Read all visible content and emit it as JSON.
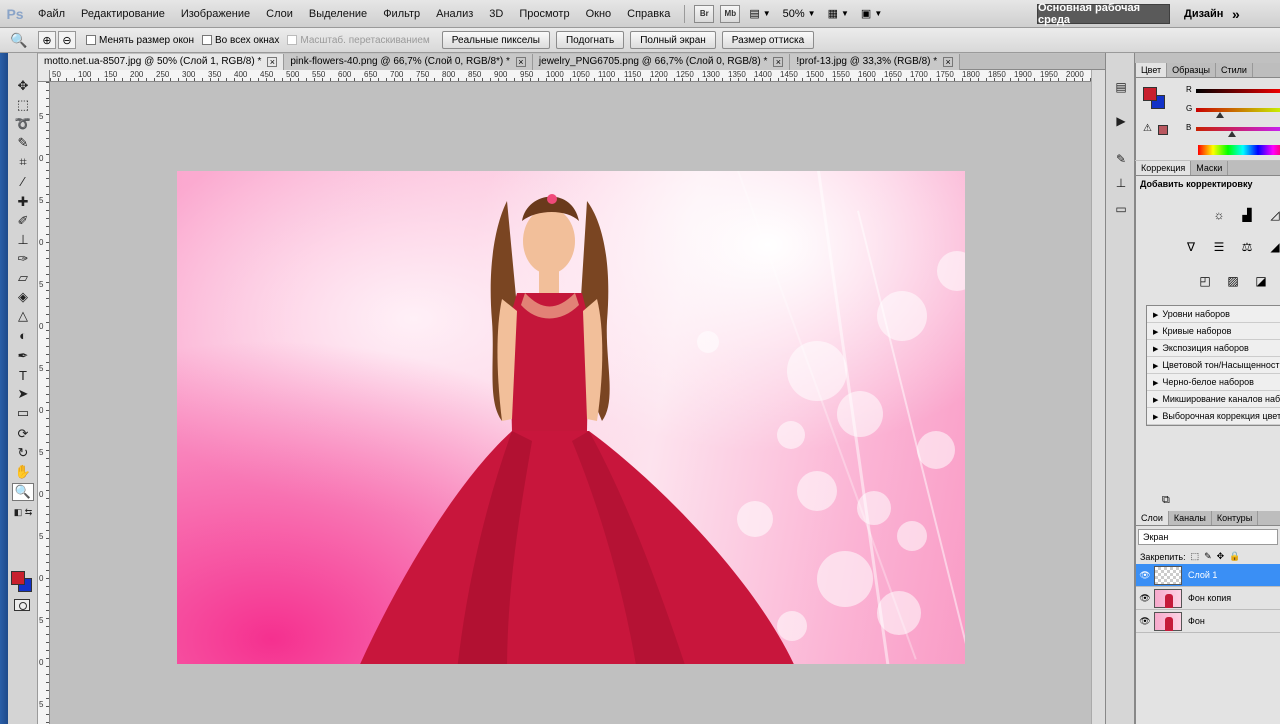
{
  "app": {
    "logo": "Ps"
  },
  "menu": {
    "items": [
      "Файл",
      "Редактирование",
      "Изображение",
      "Слои",
      "Выделение",
      "Фильтр",
      "Анализ",
      "3D",
      "Просмотр",
      "Окно",
      "Справка"
    ],
    "br_label": "Br",
    "mb_label": "Mb",
    "zoom": "50%",
    "workspace": "Основная рабочая среда",
    "design": "Дизайн",
    "more": "»"
  },
  "options": {
    "resize_windows": "Менять размер окон",
    "all_windows": "Во всех окнах",
    "scrubby_zoom": "Масштаб. перетаскиванием",
    "actual_pixels": "Реальные пикселы",
    "fit_screen": "Подогнать",
    "fill_screen": "Полный экран",
    "print_size": "Размер оттиска"
  },
  "tabs": [
    {
      "label": "motto.net.ua-8507.jpg @ 50% (Слой 1, RGB/8) *"
    },
    {
      "label": "pink-flowers-40.png @ 66,7% (Слой 0, RGB/8*) *"
    },
    {
      "label": "jewelry_PNG6705.png @ 66,7% (Слой 0, RGB/8) *"
    },
    {
      "label": "!prof-13.jpg @ 33,3% (RGB/8) *"
    }
  ],
  "rulers": {
    "top": [
      "50",
      "100",
      "150",
      "200",
      "250",
      "300",
      "350",
      "400",
      "450",
      "500",
      "550",
      "600",
      "650",
      "700",
      "750",
      "800",
      "850",
      "900",
      "950",
      "1000",
      "1050",
      "1100",
      "1150",
      "1200",
      "1250",
      "1300",
      "1350",
      "1400",
      "1450",
      "1500",
      "1550",
      "1600",
      "1650",
      "1700",
      "1750",
      "1800",
      "1850",
      "1900",
      "1950",
      "2000"
    ],
    "left": [
      "5",
      "0",
      "5",
      "0",
      "5",
      "0",
      "5",
      "0",
      "5",
      "0",
      "5",
      "0",
      "5",
      "0",
      "5"
    ]
  },
  "panels": {
    "color_tabs": [
      "Цвет",
      "Образцы",
      "Стили"
    ],
    "channels": [
      "R",
      "G",
      "B"
    ],
    "adj_tabs": [
      "Коррекция",
      "Маски"
    ],
    "adj_title": "Добавить корректировку",
    "presets": [
      "Уровни наборов",
      "Кривые наборов",
      "Экспозиция наборов",
      "Цветовой тон/Насыщенность",
      "Черно-белое наборов",
      "Микширование каналов наборов",
      "Выборочная коррекция цвета"
    ],
    "layers_tabs": [
      "Слои",
      "Каналы",
      "Контуры"
    ],
    "blend_mode": "Экран",
    "lock_label": "Закрепить:",
    "layers": [
      {
        "name": "Слой 1",
        "active": true
      },
      {
        "name": "Фон копия",
        "active": false
      },
      {
        "name": "Фон",
        "active": false
      }
    ]
  },
  "colors": {
    "foreground": "#c8202e",
    "background": "#1232c8",
    "accent": "#3a8ff5"
  }
}
